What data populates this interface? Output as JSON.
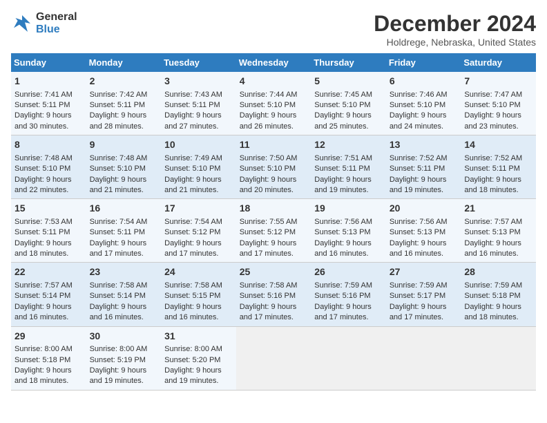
{
  "logo": {
    "line1": "General",
    "line2": "Blue"
  },
  "title": "December 2024",
  "location": "Holdrege, Nebraska, United States",
  "days_header": [
    "Sunday",
    "Monday",
    "Tuesday",
    "Wednesday",
    "Thursday",
    "Friday",
    "Saturday"
  ],
  "weeks": [
    [
      {
        "day": "1",
        "lines": [
          "Sunrise: 7:41 AM",
          "Sunset: 5:11 PM",
          "Daylight: 9 hours",
          "and 30 minutes."
        ]
      },
      {
        "day": "2",
        "lines": [
          "Sunrise: 7:42 AM",
          "Sunset: 5:11 PM",
          "Daylight: 9 hours",
          "and 28 minutes."
        ]
      },
      {
        "day": "3",
        "lines": [
          "Sunrise: 7:43 AM",
          "Sunset: 5:11 PM",
          "Daylight: 9 hours",
          "and 27 minutes."
        ]
      },
      {
        "day": "4",
        "lines": [
          "Sunrise: 7:44 AM",
          "Sunset: 5:10 PM",
          "Daylight: 9 hours",
          "and 26 minutes."
        ]
      },
      {
        "day": "5",
        "lines": [
          "Sunrise: 7:45 AM",
          "Sunset: 5:10 PM",
          "Daylight: 9 hours",
          "and 25 minutes."
        ]
      },
      {
        "day": "6",
        "lines": [
          "Sunrise: 7:46 AM",
          "Sunset: 5:10 PM",
          "Daylight: 9 hours",
          "and 24 minutes."
        ]
      },
      {
        "day": "7",
        "lines": [
          "Sunrise: 7:47 AM",
          "Sunset: 5:10 PM",
          "Daylight: 9 hours",
          "and 23 minutes."
        ]
      }
    ],
    [
      {
        "day": "8",
        "lines": [
          "Sunrise: 7:48 AM",
          "Sunset: 5:10 PM",
          "Daylight: 9 hours",
          "and 22 minutes."
        ]
      },
      {
        "day": "9",
        "lines": [
          "Sunrise: 7:48 AM",
          "Sunset: 5:10 PM",
          "Daylight: 9 hours",
          "and 21 minutes."
        ]
      },
      {
        "day": "10",
        "lines": [
          "Sunrise: 7:49 AM",
          "Sunset: 5:10 PM",
          "Daylight: 9 hours",
          "and 21 minutes."
        ]
      },
      {
        "day": "11",
        "lines": [
          "Sunrise: 7:50 AM",
          "Sunset: 5:10 PM",
          "Daylight: 9 hours",
          "and 20 minutes."
        ]
      },
      {
        "day": "12",
        "lines": [
          "Sunrise: 7:51 AM",
          "Sunset: 5:11 PM",
          "Daylight: 9 hours",
          "and 19 minutes."
        ]
      },
      {
        "day": "13",
        "lines": [
          "Sunrise: 7:52 AM",
          "Sunset: 5:11 PM",
          "Daylight: 9 hours",
          "and 19 minutes."
        ]
      },
      {
        "day": "14",
        "lines": [
          "Sunrise: 7:52 AM",
          "Sunset: 5:11 PM",
          "Daylight: 9 hours",
          "and 18 minutes."
        ]
      }
    ],
    [
      {
        "day": "15",
        "lines": [
          "Sunrise: 7:53 AM",
          "Sunset: 5:11 PM",
          "Daylight: 9 hours",
          "and 18 minutes."
        ]
      },
      {
        "day": "16",
        "lines": [
          "Sunrise: 7:54 AM",
          "Sunset: 5:11 PM",
          "Daylight: 9 hours",
          "and 17 minutes."
        ]
      },
      {
        "day": "17",
        "lines": [
          "Sunrise: 7:54 AM",
          "Sunset: 5:12 PM",
          "Daylight: 9 hours",
          "and 17 minutes."
        ]
      },
      {
        "day": "18",
        "lines": [
          "Sunrise: 7:55 AM",
          "Sunset: 5:12 PM",
          "Daylight: 9 hours",
          "and 17 minutes."
        ]
      },
      {
        "day": "19",
        "lines": [
          "Sunrise: 7:56 AM",
          "Sunset: 5:13 PM",
          "Daylight: 9 hours",
          "and 16 minutes."
        ]
      },
      {
        "day": "20",
        "lines": [
          "Sunrise: 7:56 AM",
          "Sunset: 5:13 PM",
          "Daylight: 9 hours",
          "and 16 minutes."
        ]
      },
      {
        "day": "21",
        "lines": [
          "Sunrise: 7:57 AM",
          "Sunset: 5:13 PM",
          "Daylight: 9 hours",
          "and 16 minutes."
        ]
      }
    ],
    [
      {
        "day": "22",
        "lines": [
          "Sunrise: 7:57 AM",
          "Sunset: 5:14 PM",
          "Daylight: 9 hours",
          "and 16 minutes."
        ]
      },
      {
        "day": "23",
        "lines": [
          "Sunrise: 7:58 AM",
          "Sunset: 5:14 PM",
          "Daylight: 9 hours",
          "and 16 minutes."
        ]
      },
      {
        "day": "24",
        "lines": [
          "Sunrise: 7:58 AM",
          "Sunset: 5:15 PM",
          "Daylight: 9 hours",
          "and 16 minutes."
        ]
      },
      {
        "day": "25",
        "lines": [
          "Sunrise: 7:58 AM",
          "Sunset: 5:16 PM",
          "Daylight: 9 hours",
          "and 17 minutes."
        ]
      },
      {
        "day": "26",
        "lines": [
          "Sunrise: 7:59 AM",
          "Sunset: 5:16 PM",
          "Daylight: 9 hours",
          "and 17 minutes."
        ]
      },
      {
        "day": "27",
        "lines": [
          "Sunrise: 7:59 AM",
          "Sunset: 5:17 PM",
          "Daylight: 9 hours",
          "and 17 minutes."
        ]
      },
      {
        "day": "28",
        "lines": [
          "Sunrise: 7:59 AM",
          "Sunset: 5:18 PM",
          "Daylight: 9 hours",
          "and 18 minutes."
        ]
      }
    ],
    [
      {
        "day": "29",
        "lines": [
          "Sunrise: 8:00 AM",
          "Sunset: 5:18 PM",
          "Daylight: 9 hours",
          "and 18 minutes."
        ]
      },
      {
        "day": "30",
        "lines": [
          "Sunrise: 8:00 AM",
          "Sunset: 5:19 PM",
          "Daylight: 9 hours",
          "and 19 minutes."
        ]
      },
      {
        "day": "31",
        "lines": [
          "Sunrise: 8:00 AM",
          "Sunset: 5:20 PM",
          "Daylight: 9 hours",
          "and 19 minutes."
        ]
      },
      {
        "day": "",
        "lines": []
      },
      {
        "day": "",
        "lines": []
      },
      {
        "day": "",
        "lines": []
      },
      {
        "day": "",
        "lines": []
      }
    ]
  ]
}
